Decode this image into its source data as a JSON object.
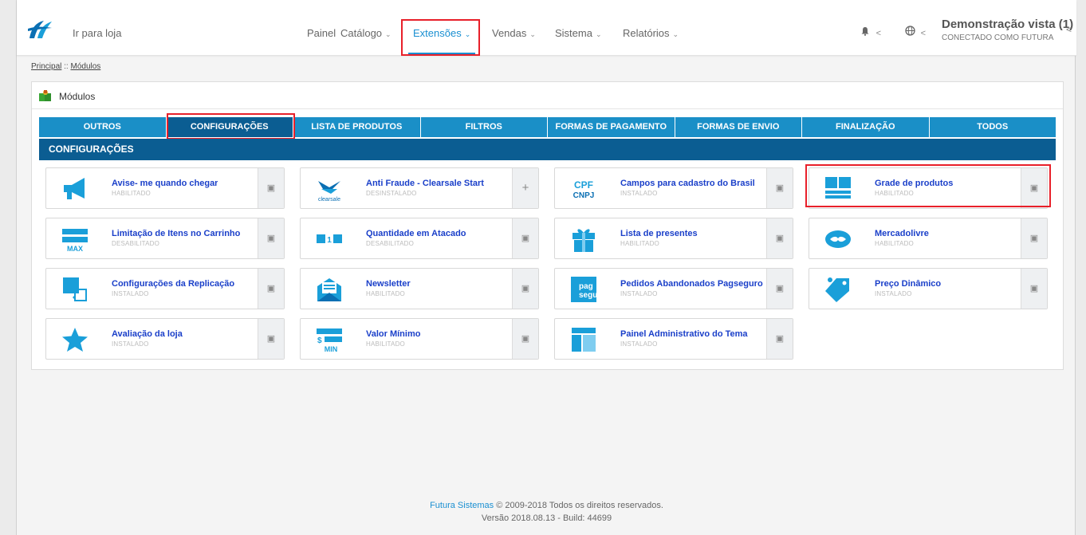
{
  "header": {
    "goto_store": "Ir para loja",
    "nav": [
      {
        "label": "Painel",
        "has_menu": false
      },
      {
        "label": "Catálogo",
        "has_menu": true
      },
      {
        "label": "Extensões",
        "has_menu": true,
        "active": true
      },
      {
        "label": "Vendas",
        "has_menu": true
      },
      {
        "label": "Sistema",
        "has_menu": true
      },
      {
        "label": "Relatórios",
        "has_menu": true
      }
    ],
    "chevron": "⌄",
    "bell_icon": "bell-icon",
    "globe_icon": "globe-icon",
    "user_name": "Demonstração vista (1)",
    "user_sub": "CONECTADO COMO FUTURA"
  },
  "breadcrumb": {
    "home": "Principal",
    "separator": "::",
    "current": "Módulos"
  },
  "panel": {
    "title": "Módulos",
    "tabs": [
      "OUTROS",
      "CONFIGURAÇÕES",
      "LISTA DE PRODUTOS",
      "FILTROS",
      "FORMAS DE PAGAMENTO",
      "FORMAS DE ENVIO",
      "FINALIZAÇÃO",
      "TODOS"
    ],
    "active_tab": 1,
    "section_title": "CONFIGURAÇÕES"
  },
  "modules": [
    {
      "name": "Avise- me quando chegar",
      "status": "HABILITADO",
      "icon": "megaphone-icon",
      "action": "delete"
    },
    {
      "name": "Anti Fraude - Clearsale Start",
      "status": "DESINSTALADO",
      "icon": "clearsale-logo-icon",
      "action": "install"
    },
    {
      "name": "Campos para cadastro do Brasil",
      "status": "INSTALADO",
      "icon": "cpf-cnpj-icon",
      "action": "delete"
    },
    {
      "name": "Grade de produtos",
      "status": "HABILITADO",
      "icon": "grid-icon",
      "action": "delete"
    },
    {
      "name": "Limitação de Itens no Carrinho",
      "status": "DESABILITADO",
      "icon": "max-icon",
      "action": "delete"
    },
    {
      "name": "Quantidade em Atacado",
      "status": "DESABILITADO",
      "icon": "wholesale-icon",
      "action": "delete"
    },
    {
      "name": "Lista de presentes",
      "status": "HABILITADO",
      "icon": "gift-icon",
      "action": "delete"
    },
    {
      "name": "Mercadolivre",
      "status": "HABILITADO",
      "icon": "handshake-icon",
      "action": "delete"
    },
    {
      "name": "Configurações da Replicação",
      "status": "INSTALADO",
      "icon": "replication-icon",
      "action": "delete"
    },
    {
      "name": "Newsletter",
      "status": "HABILITADO",
      "icon": "newsletter-icon",
      "action": "delete"
    },
    {
      "name": "Pedidos Abandonados Pagseguro",
      "status": "INSTALADO",
      "icon": "pagseguro-icon",
      "action": "delete"
    },
    {
      "name": "Preço Dinâmico",
      "status": "INSTALADO",
      "icon": "price-tag-icon",
      "action": "delete"
    },
    {
      "name": "Avaliação da loja",
      "status": "INSTALADO",
      "icon": "star-icon",
      "action": "delete"
    },
    {
      "name": "Valor Mínimo",
      "status": "HABILITADO",
      "icon": "min-value-icon",
      "action": "delete"
    },
    {
      "name": "Painel Administrativo do Tema",
      "status": "INSTALADO",
      "icon": "theme-panel-icon",
      "action": "delete"
    }
  ],
  "icon_text": {
    "max": "MAX",
    "min": "MIN",
    "dollar": "$",
    "one": "1",
    "cpf": "CPF",
    "cnpj": "CNPJ",
    "clearsale": "clearsale",
    "pag": "pag",
    "segu": "segu"
  },
  "footer": {
    "brand": "Futura Sistemas",
    "copyright": "© 2009-2018 Todos os direitos reservados.",
    "version": "Versão 2018.08.13 - Build: 44699"
  },
  "colors": {
    "tab": "#1a8fc7",
    "tab_active": "#0b5d92",
    "icon": "#1a9fd9",
    "link": "#1a3fc9",
    "highlight": "#e8202a",
    "nav_active": "#1a8fd1"
  }
}
